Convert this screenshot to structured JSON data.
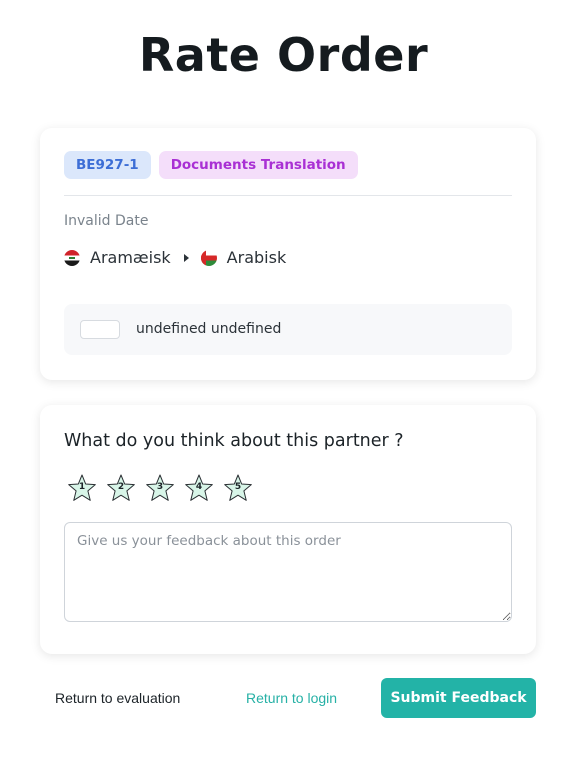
{
  "page": {
    "title": "Rate Order"
  },
  "order": {
    "code": "BE927-1",
    "service": "Documents Translation",
    "date": "Invalid Date",
    "source_language": "Aramæisk",
    "target_language": "Arabisk",
    "source_flag_icon": "iraq-flag-icon",
    "target_flag_icon": "oman-flag-icon",
    "partner_name": "undefined undefined"
  },
  "rating": {
    "question": "What do you think about this partner ?",
    "stars": [
      "1",
      "2",
      "3",
      "4",
      "5"
    ],
    "star_fill_color": "#d8f5e8",
    "star_stroke_color": "#2a2f33",
    "feedback_placeholder": "Give us your feedback about this order",
    "feedback_value": ""
  },
  "actions": {
    "return_evaluation": "Return to evaluation",
    "return_login": "Return to login",
    "submit": "Submit Feedback"
  },
  "colors": {
    "accent": "#23b3a7",
    "badge_code_bg": "#dbe7fb",
    "badge_code_text": "#3d6ed6",
    "badge_service_bg": "#f4defa",
    "badge_service_text": "#a930d4"
  }
}
